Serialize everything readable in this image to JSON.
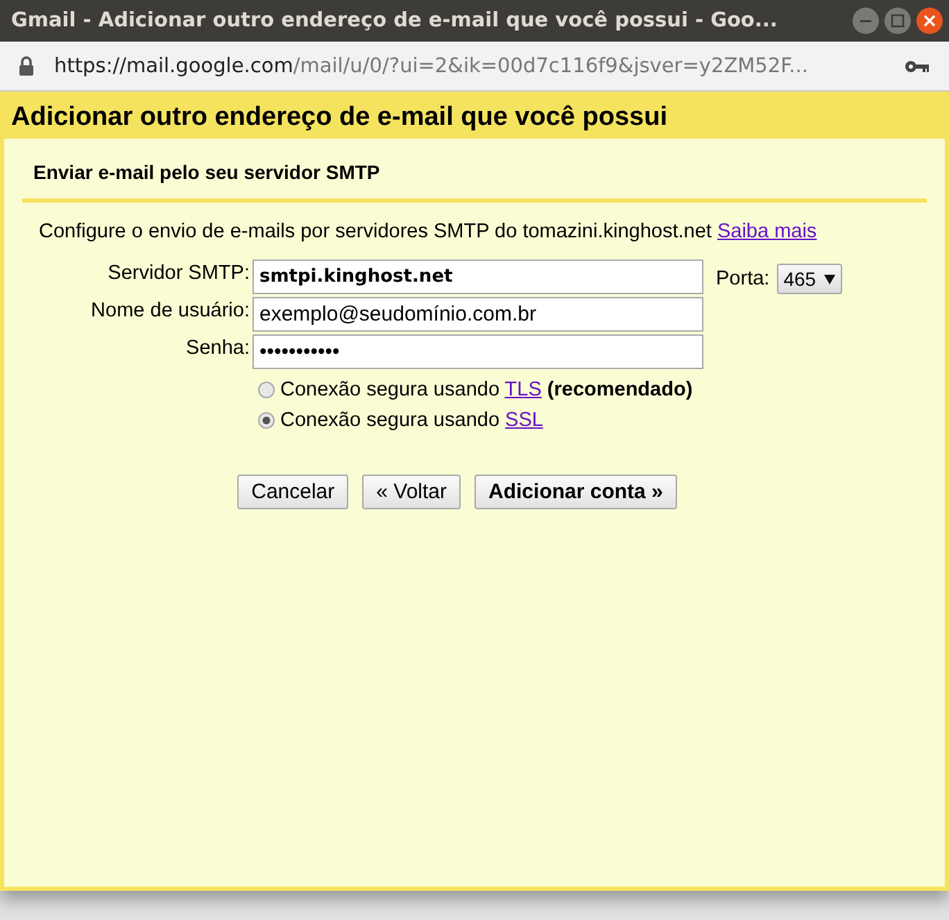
{
  "window": {
    "title": "Gmail - Adicionar outro endereço de e-mail que você possui - Goo..."
  },
  "address_bar": {
    "host": "https://mail.google.com",
    "path": "/mail/u/0/?ui=2&ik=00d7c116f9&jsver=y2ZM52F..."
  },
  "dialog": {
    "title": "Adicionar outro endereço de e-mail que você possui",
    "section": "Enviar e-mail pelo seu servidor SMTP",
    "intro": "Configure o envio de e-mails por servidores SMTP do tomazini.kinghost.net",
    "intro_link": "Saiba mais",
    "fields": [
      {
        "label": "Servidor SMTP:",
        "value": "smtpi.kinghost.net",
        "bold": true
      },
      {
        "label": "Nome de usuário:",
        "value": "exemplo@seudomínio.com.br",
        "bold": false
      },
      {
        "label": "Senha:",
        "value": "•••••••••••",
        "bold": false
      }
    ],
    "port": {
      "label": "Porta:",
      "value": "465"
    },
    "security": [
      {
        "text": "Conexão segura usando ",
        "link": "TLS",
        "note": "(recomendado)",
        "selected": false
      },
      {
        "text": "Conexão segura usando ",
        "link": "SSL",
        "selected": true
      }
    ],
    "buttons": [
      {
        "label": "Cancelar",
        "primary": false
      },
      {
        "label": "« Voltar",
        "primary": false
      },
      {
        "label": "Adicionar conta »",
        "primary": true
      }
    ]
  }
}
